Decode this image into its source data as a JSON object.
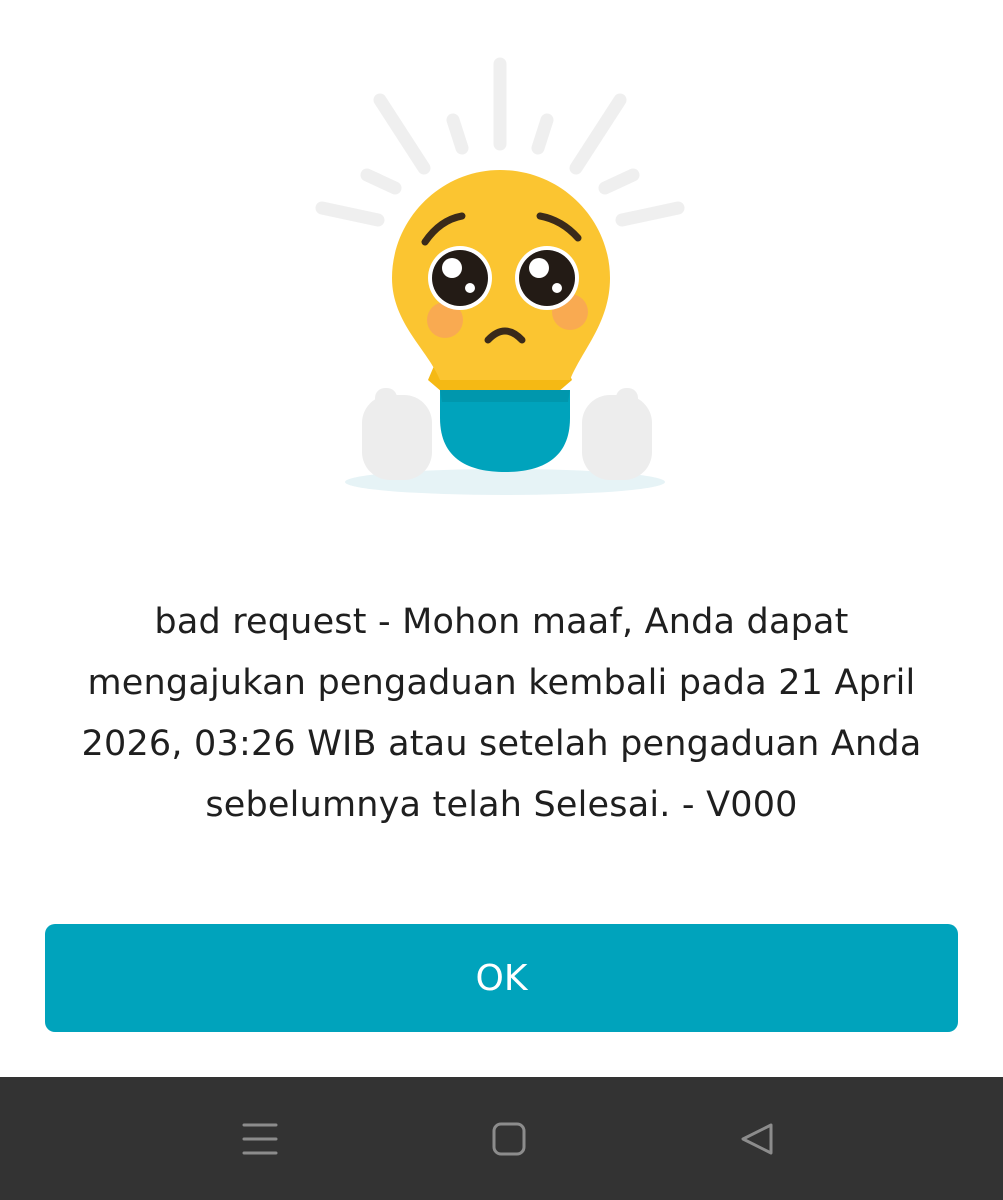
{
  "dialog": {
    "illustration": "sad-lightbulb-illustration",
    "message_lines": [
      "bad request - Mohon maaf, Anda dapat",
      "mengajukan pengaduan kembali pada 21 April",
      "2026, 03:26 WIB atau setelah pengaduan Anda",
      "sebelumnya telah Selesai. - V000"
    ],
    "ok_label": "OK"
  },
  "navbar": {
    "menu_icon": "menu-lines-icon",
    "home_icon": "square-home-icon",
    "back_icon": "triangle-back-icon"
  },
  "colors": {
    "accent": "#00a3bc",
    "navbar": "#333333",
    "text": "#1f1f1f",
    "face": "#fbc531",
    "shirt": "#00a3bc"
  }
}
